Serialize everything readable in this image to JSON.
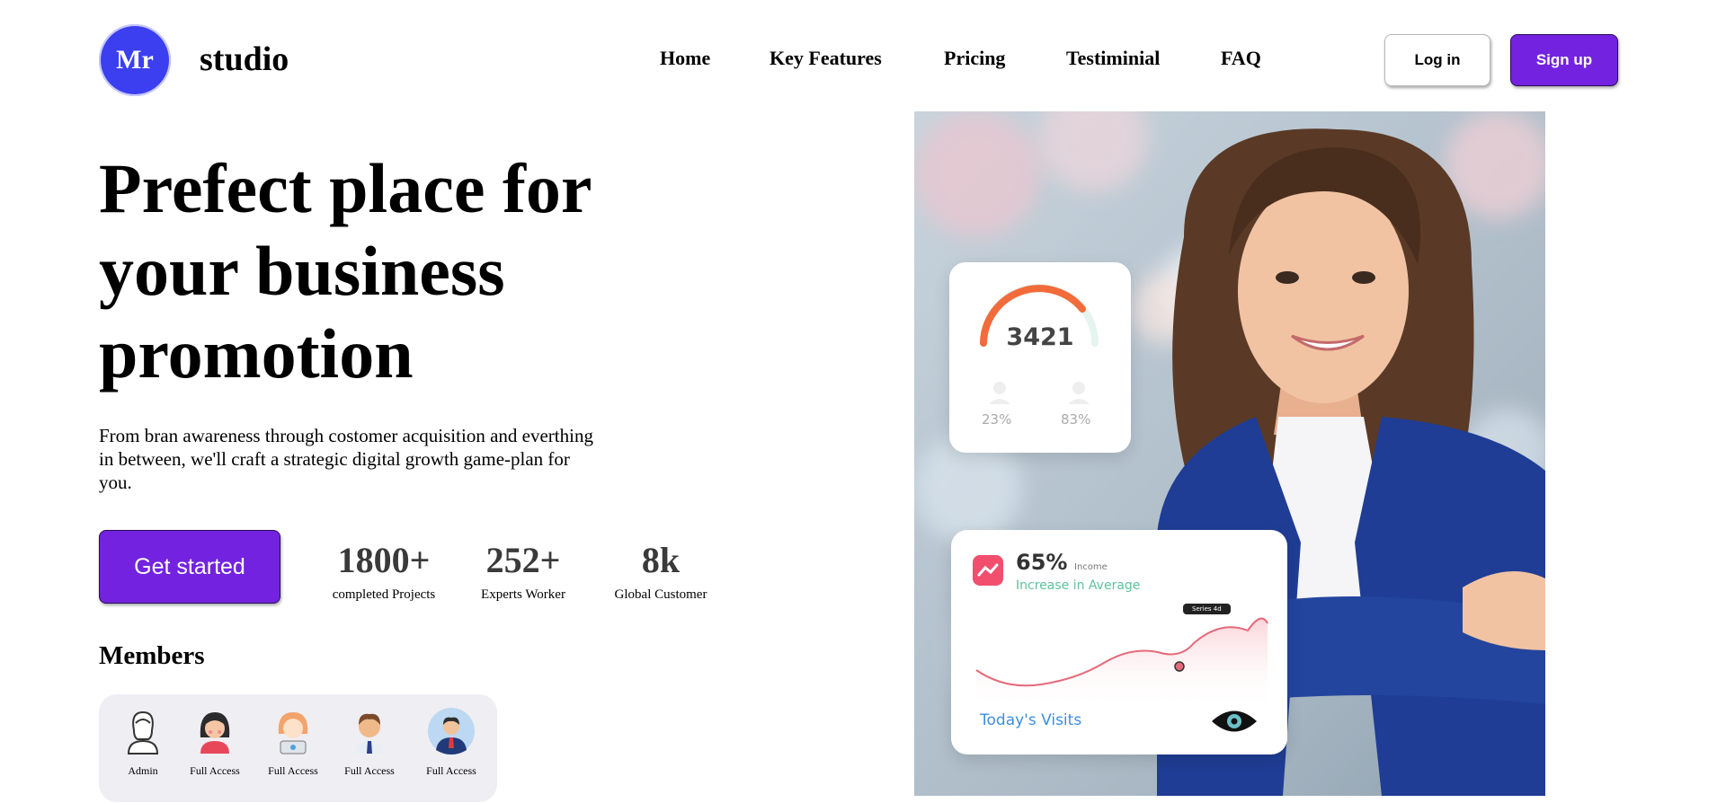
{
  "navbar": {
    "logo_text": "Mr",
    "brand": "studio",
    "links": [
      "Home",
      "Key Features",
      "Pricing",
      "Testiminial",
      "FAQ"
    ],
    "login_label": "Log in",
    "signup_label": "Sign up"
  },
  "hero": {
    "headline": "Prefect place for your business promotion",
    "subtext": "From bran awareness through costomer acquisition and everthing in between, we'll craft a strategic digital growth game-plan for you.",
    "cta_label": "Get started",
    "stats": [
      {
        "value": "1800+",
        "label": "completed Projects"
      },
      {
        "value": "252+",
        "label": "Experts Worker"
      },
      {
        "value": "8k",
        "label": "Global Customer"
      }
    ]
  },
  "members": {
    "title": "Members",
    "items": [
      {
        "label": "Admin",
        "icon": "woman-outline-avatar-icon"
      },
      {
        "label": "Full Access",
        "icon": "woman-dark-hair-avatar-icon"
      },
      {
        "label": "Full Access",
        "icon": "woman-laptop-avatar-icon"
      },
      {
        "label": "Full Access",
        "icon": "man-tie-avatar-icon"
      },
      {
        "label": "Full Access",
        "icon": "man-suit-avatar-icon"
      }
    ]
  },
  "hero_image": {
    "gauge_card": {
      "value": "3421",
      "left_pct": "23%",
      "right_pct": "83%"
    },
    "income_card": {
      "percent": "65%",
      "label": "Income",
      "subtitle": "Increase in Average",
      "tag": "Series 4d",
      "footer": "Today's Visits"
    }
  },
  "colors": {
    "brand_blue": "#3b3ff0",
    "accent_purple": "#7323e0",
    "jacket_blue": "#1f3d94"
  }
}
